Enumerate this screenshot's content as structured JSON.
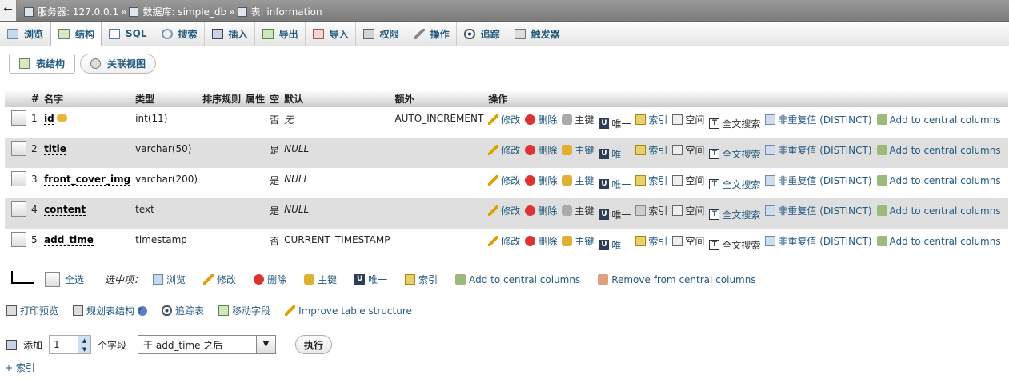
{
  "breadcrumb": {
    "server_label": "服务器: 127.0.0.1",
    "sep1": "»",
    "db_label": "数据库: simple_db",
    "sep2": "»",
    "table_label": "表: information"
  },
  "tabs": [
    {
      "label": "浏览"
    },
    {
      "label": "结构"
    },
    {
      "label": "SQL"
    },
    {
      "label": "搜索"
    },
    {
      "label": "插入"
    },
    {
      "label": "导出"
    },
    {
      "label": "导入"
    },
    {
      "label": "权限"
    },
    {
      "label": "操作"
    },
    {
      "label": "追踪"
    },
    {
      "label": "触发器"
    }
  ],
  "subtabs": {
    "table_structure": "表结构",
    "relation_view": "关联视图"
  },
  "columns": {
    "num": "#",
    "name": "名字",
    "type": "类型",
    "collation": "排序规则",
    "attributes": "属性",
    "null": "空",
    "default": "默认",
    "extra": "额外",
    "action": "操作"
  },
  "rows": [
    {
      "num": "1",
      "name": "id",
      "type": "int(11)",
      "null": "否",
      "default": "无",
      "extra": "AUTO_INCREMENT"
    },
    {
      "num": "2",
      "name": "title",
      "type": "varchar(50)",
      "null": "是",
      "default": "NULL",
      "extra": ""
    },
    {
      "num": "3",
      "name": "front_cover_img",
      "type": "varchar(200)",
      "null": "是",
      "default": "NULL",
      "extra": ""
    },
    {
      "num": "4",
      "name": "content",
      "type": "text",
      "null": "是",
      "default": "NULL",
      "extra": ""
    },
    {
      "num": "5",
      "name": "add_time",
      "type": "timestamp",
      "null": "否",
      "default": "CURRENT_TIMESTAMP",
      "extra": ""
    }
  ],
  "actions": {
    "change": "修改",
    "drop": "删除",
    "primary": "主键",
    "unique": "唯一",
    "index": "索引",
    "spatial": "空间",
    "fulltext": "全文搜索",
    "distinct": "非重复值 (DISTINCT)",
    "central": "Add to central columns"
  },
  "bulk": {
    "check_all": "全选",
    "with_selected": "选中项：",
    "browse": "浏览",
    "change": "修改",
    "drop": "删除",
    "primary": "主键",
    "unique": "唯一",
    "index": "索引",
    "add_central": "Add to central columns",
    "remove_central": "Remove from central columns"
  },
  "tools": {
    "print": "打印预览",
    "propose": "规划表结构",
    "help": "?",
    "track": "追踪表",
    "move": "移动字段",
    "improve": "Improve table structure"
  },
  "add": {
    "label": "添加",
    "count": "1",
    "unit": "个字段",
    "position": "于 add_time 之后",
    "go": "执行"
  },
  "add_index": "+ 索引"
}
